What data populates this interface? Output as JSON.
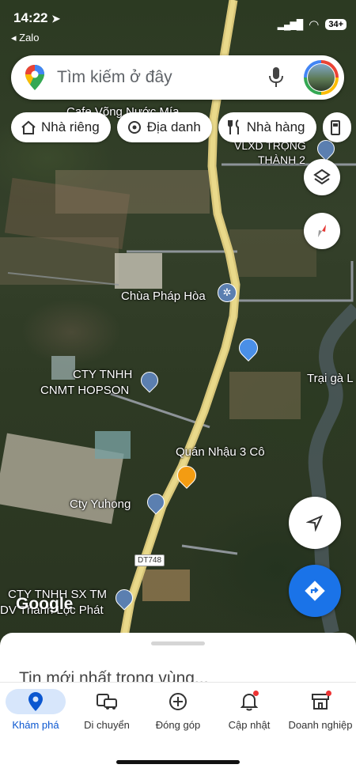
{
  "status_bar": {
    "time": "14:22",
    "back_app": "◂ Zalo",
    "battery": "34+"
  },
  "search": {
    "placeholder": "Tìm kiếm ở đây"
  },
  "chips": [
    {
      "label": "Nhà riêng",
      "icon": "home-icon"
    },
    {
      "label": "Địa danh",
      "icon": "landmark-icon"
    },
    {
      "label": "Nhà hàng",
      "icon": "restaurant-icon"
    }
  ],
  "map": {
    "watermark": "Google",
    "labels": {
      "cafe": "Cafe Võng Nước Mía",
      "vlxd": "VLXD TRỌNG",
      "vlxd2": "THÀNH 2",
      "pagoda": "Chùa Pháp Hòa",
      "cty_hopson_1": "CTY TNHH",
      "cty_hopson_2": "CNMT HOPSON",
      "farm": "Trại gà L",
      "quan_nhau": "Quán Nhậu 3 Cô",
      "yuhong": "Cty Yuhong",
      "road": "DT748",
      "cty_sx_1": "CTY TNHH SX TM",
      "cty_sx_2": "DV Thanh Lộc Phát"
    }
  },
  "sheet": {
    "headline": "Tin mới nhất trong vùng..."
  },
  "nav": [
    {
      "label": "Khám phá",
      "icon": "explore-pin-icon",
      "active": true
    },
    {
      "label": "Di chuyển",
      "icon": "commute-icon"
    },
    {
      "label": "Đóng góp",
      "icon": "contribute-plus-icon"
    },
    {
      "label": "Cập nhật",
      "icon": "bell-icon"
    },
    {
      "label": "Doanh nghiệp",
      "icon": "store-icon"
    }
  ],
  "colors": {
    "accent": "#0b57d0",
    "directions": "#1a73e8",
    "road": "#d9c77a"
  }
}
